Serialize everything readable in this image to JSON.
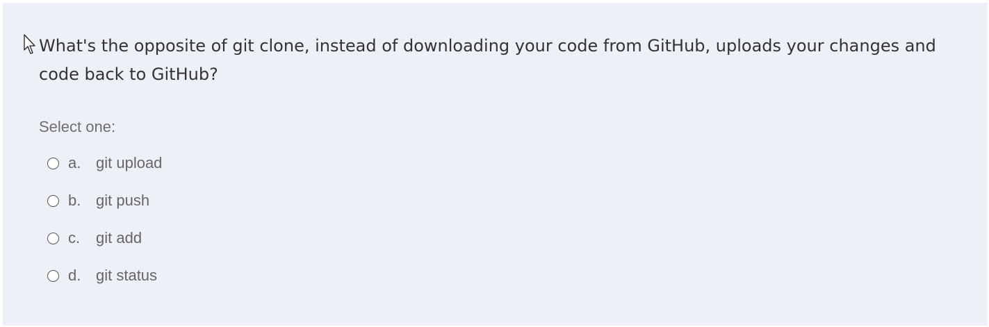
{
  "question": {
    "text": "What's the opposite of git clone, instead of downloading your code from GitHub, uploads your changes and code back to GitHub?",
    "prompt": "Select one:",
    "options": [
      {
        "letter": "a.",
        "text": "git upload",
        "selected": false
      },
      {
        "letter": "b.",
        "text": "git push",
        "selected": false
      },
      {
        "letter": "c.",
        "text": "git add",
        "selected": false
      },
      {
        "letter": "d.",
        "text": "git status",
        "selected": false
      }
    ]
  },
  "icons": {
    "cursor": "mouse-pointer-icon"
  },
  "colors": {
    "card_background": "#edf0f7",
    "question_text": "#333333",
    "option_text": "#666666"
  }
}
